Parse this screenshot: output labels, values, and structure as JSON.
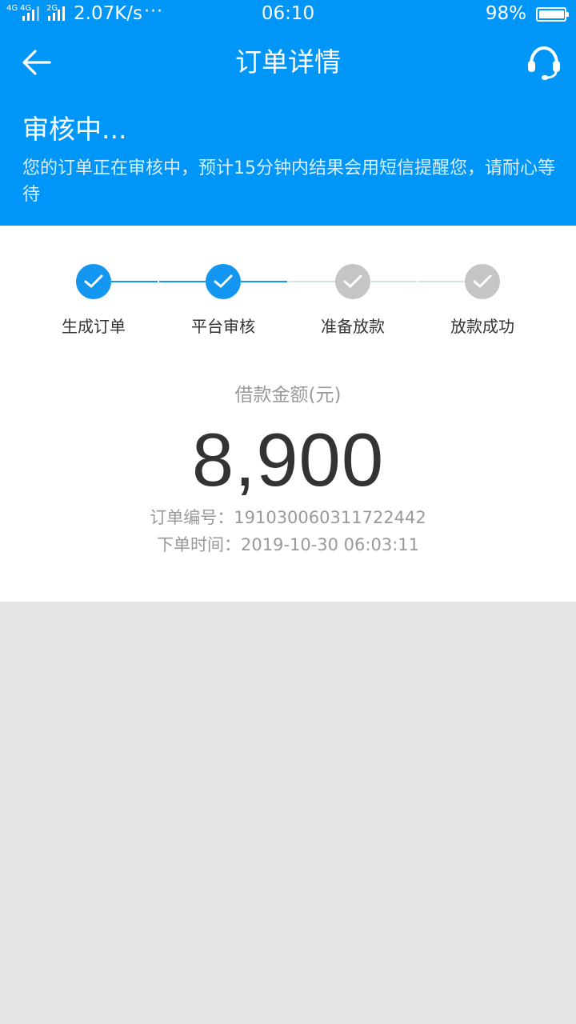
{
  "status_bar": {
    "sig1": "4G",
    "sig2": "4G",
    "sig3": "2G",
    "speed": "2.07K/s",
    "more": "···",
    "time": "06:10",
    "battery_pct": "98%"
  },
  "header": {
    "title": "订单详情",
    "back_icon": "arrow-left-icon",
    "service_icon": "headset-icon"
  },
  "order_status": {
    "title": "审核中...",
    "description": "您的订单正在审核中，预计15分钟内结果会用短信提醒您，请耐心等待"
  },
  "steps": [
    {
      "label": "生成订单",
      "done": true
    },
    {
      "label": "平台审核",
      "done": true
    },
    {
      "label": "准备放款",
      "done": false
    },
    {
      "label": "放款成功",
      "done": false
    }
  ],
  "loan": {
    "amount_label": "借款金额(元)",
    "amount": "8,900",
    "order_no_label": "订单编号：",
    "order_no": "19103006031172244 2",
    "order_line": "订单编号：191030060311722442",
    "time_line": "下单时间：2019-10-30 06:03:11"
  },
  "colors": {
    "primary": "#0096f8",
    "step_active": "#1296f0",
    "step_inactive": "#c5c5c5",
    "page_bg": "#e5e5e5"
  }
}
